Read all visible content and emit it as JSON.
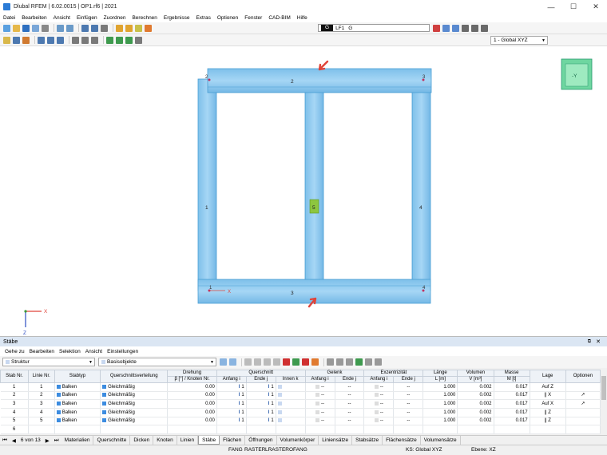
{
  "window": {
    "title": "Dlubal RFEM | 6.02.0015 | OP1.rf6 | 2021",
    "min": "—",
    "max": "☐",
    "close": "✕"
  },
  "menu": [
    "Datei",
    "Bearbeiten",
    "Ansicht",
    "Einfügen",
    "Zuordnen",
    "Berechnen",
    "Ergebnisse",
    "Extras",
    "Optionen",
    "Fenster",
    "CAD-BIM",
    "Hilfe"
  ],
  "toolbar": {
    "loadcase_code": "G",
    "loadcase_id": "LF1",
    "loadcase_name": "G",
    "view": "1 - Global XYZ"
  },
  "viewport": {
    "node_labels": [
      "1",
      "2",
      "3",
      "4"
    ],
    "member_labels": [
      "1",
      "2",
      "3",
      "4",
      "5"
    ],
    "axis_x": "X",
    "axis_z": "Z",
    "viewcube_label": "-Y"
  },
  "panel": {
    "title": "Stäbe",
    "menu": [
      "Gehe zu",
      "Bearbeiten",
      "Selektion",
      "Ansicht",
      "Einstellungen"
    ],
    "filter": "Struktur",
    "objects": "Basisobjekte"
  },
  "table": {
    "header1": {
      "drehung": "Drehung",
      "querschnitt": "Querschnitt",
      "gelenk": "Gelenk",
      "exzentrizitaet": "Exzentrizität",
      "laenge": "Länge",
      "volumen": "Volumen",
      "masse": "Masse"
    },
    "header2": {
      "stab_nr": "Stab Nr.",
      "linie_nr": "Linie Nr.",
      "stabtyp": "Stabtyp",
      "qverteilung": "Querschnittsverteilung",
      "beta": "β [°] / Knoten Nr.",
      "anfang_i": "Anfang i",
      "ende_j": "Ende j",
      "innen_k": "Innen k",
      "g_anfang": "Anfang i",
      "g_ende": "Ende j",
      "e_anfang": "Anfang i",
      "e_ende": "Ende j",
      "l": "L [m]",
      "v": "V [m³]",
      "m": "M [t]",
      "lage": "Lage",
      "optionen": "Optionen"
    },
    "rows": [
      {
        "nr": "1",
        "linie": "1",
        "typ": "Balken",
        "vert": "Gleichmäßig",
        "beta": "0.00",
        "qa": "1",
        "qe": "1",
        "ga": "--",
        "ge": "--",
        "ea": "--",
        "ee": "--",
        "l": "1.000",
        "v": "0.002",
        "m": "0.017",
        "lage": "Auf Z",
        "opt": ""
      },
      {
        "nr": "2",
        "linie": "2",
        "typ": "Balken",
        "vert": "Gleichmäßig",
        "beta": "0.00",
        "qa": "1",
        "qe": "1",
        "ga": "--",
        "ge": "--",
        "ea": "--",
        "ee": "--",
        "l": "1.000",
        "v": "0.002",
        "m": "0.017",
        "lage": "|| X",
        "opt": "↗"
      },
      {
        "nr": "3",
        "linie": "3",
        "typ": "Balken",
        "vert": "Gleichmäßig",
        "beta": "0.00",
        "qa": "1",
        "qe": "1",
        "ga": "--",
        "ge": "--",
        "ea": "--",
        "ee": "--",
        "l": "1.000",
        "v": "0.002",
        "m": "0.017",
        "lage": "Auf X",
        "opt": "↗"
      },
      {
        "nr": "4",
        "linie": "4",
        "typ": "Balken",
        "vert": "Gleichmäßig",
        "beta": "0.00",
        "qa": "1",
        "qe": "1",
        "ga": "--",
        "ge": "--",
        "ea": "--",
        "ee": "--",
        "l": "1.000",
        "v": "0.002",
        "m": "0.017",
        "lage": "|| Z",
        "opt": ""
      },
      {
        "nr": "5",
        "linie": "5",
        "typ": "Balken",
        "vert": "Gleichmäßig",
        "beta": "0.00",
        "qa": "1",
        "qe": "1",
        "ga": "--",
        "ge": "--",
        "ea": "--",
        "ee": "--",
        "l": "1.000",
        "v": "0.002",
        "m": "0.017",
        "lage": "|| Z",
        "opt": ""
      },
      {
        "nr": "6",
        "linie": "",
        "typ": "",
        "vert": "",
        "beta": "",
        "qa": "",
        "qe": "",
        "ga": "",
        "ge": "",
        "ea": "",
        "ee": "",
        "l": "",
        "v": "",
        "m": "",
        "lage": "",
        "opt": ""
      }
    ]
  },
  "tabs": {
    "page": "6 von 13",
    "items": [
      "Materialien",
      "Querschnitte",
      "Dicken",
      "Knoten",
      "Linien",
      "Stäbe",
      "Flächen",
      "Öffnungen",
      "Volumenkörper",
      "Liniensätze",
      "Stabsätze",
      "Flächensätze",
      "Volumensätze"
    ],
    "active": 5
  },
  "status": {
    "items": [
      "FANG",
      "RASTER",
      "LRASTER",
      "OFANG"
    ],
    "ks": "KS: Global XYZ",
    "ebene": "Ebene: XZ"
  },
  "colors": {
    "member": "#8ecbf0",
    "member_edge": "#4a9fd4",
    "arrow": "#e0443a",
    "accent": "#2b7bd6"
  }
}
